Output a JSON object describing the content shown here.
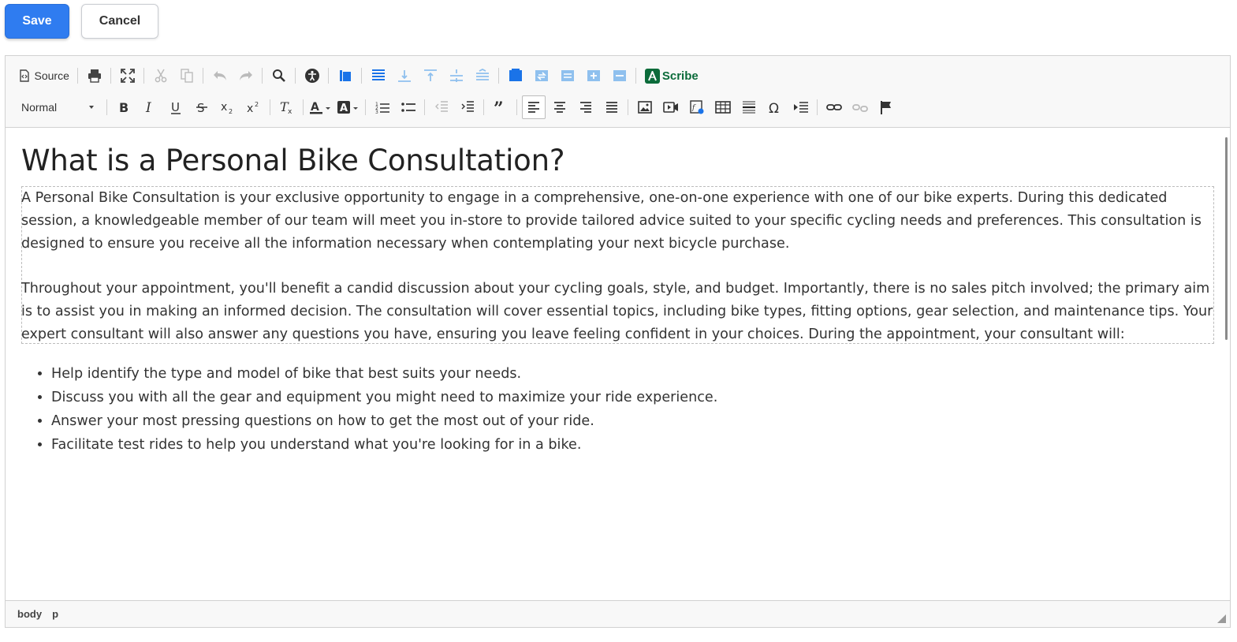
{
  "actions": {
    "save_label": "Save",
    "cancel_label": "Cancel"
  },
  "toolbar": {
    "source_label": "Source",
    "scribe_label": "Scribe",
    "format_value": "Normal",
    "icons_row1": [
      "source-icon",
      "print-icon",
      "maximize-icon",
      "cut-icon",
      "copy-icon",
      "undo-icon",
      "redo-icon",
      "find-icon",
      "accessibility-icon",
      "layout-icon",
      "align-block-icon",
      "insert-below-icon",
      "insert-above-icon",
      "insert-middle-icon",
      "collapse-icon",
      "section-icon",
      "section-wrap-icon",
      "section-up-icon",
      "section-add-icon",
      "section-down-icon",
      "scribe-icon"
    ],
    "icons_row2": [
      "bold-icon",
      "italic-icon",
      "underline-icon",
      "strikethrough-icon",
      "subscript-icon",
      "superscript-icon",
      "remove-format-icon",
      "text-color-icon",
      "background-color-icon",
      "numbered-list-icon",
      "bulleted-list-icon",
      "outdent-icon",
      "indent-icon",
      "blockquote-icon",
      "align-left-icon",
      "align-center-icon",
      "align-right-icon",
      "justify-icon",
      "image-icon",
      "video-icon",
      "formula-icon",
      "table-icon",
      "horizontal-rule-icon",
      "special-char-icon",
      "page-break-icon",
      "link-icon",
      "unlink-icon",
      "anchor-icon"
    ]
  },
  "content": {
    "title": "What is a Personal Bike Consultation?",
    "paragraph1": "A Personal Bike Consultation is your exclusive opportunity to engage in a comprehensive, one-on-one experience with one of our bike experts. During this dedicated session, a knowledgeable member of our team will meet you in-store to provide tailored advice suited to your specific cycling needs and preferences. This consultation is designed to ensure you receive all the information necessary when contemplating your next bicycle purchase.",
    "paragraph2": "Throughout your appointment, you'll benefit a candid discussion about your cycling goals, style, and budget. Importantly, there is no sales pitch involved; the primary aim is to assist you in making an informed decision. The consultation will cover essential topics, including bike types, fitting options, gear selection, and maintenance tips. Your expert consultant will also answer any questions you have, ensuring you leave feeling confident in your choices. During the appointment, your consultant will:",
    "bullets": [
      "Help identify the type and model of bike that best suits your needs.",
      "Discuss you with all the gear and equipment you might need to maximize your ride experience.",
      "Answer your most pressing questions on how to get the most out of your ride.",
      "Facilitate test rides to help you understand what you're looking for in a bike."
    ]
  },
  "statusbar": {
    "path": [
      "body",
      "p"
    ]
  },
  "colors": {
    "primary": "#2f7cf0",
    "scribe": "#0b6b3a",
    "blue_icon": "#1a73e8",
    "light_blue_icon": "#8fc0ee"
  }
}
